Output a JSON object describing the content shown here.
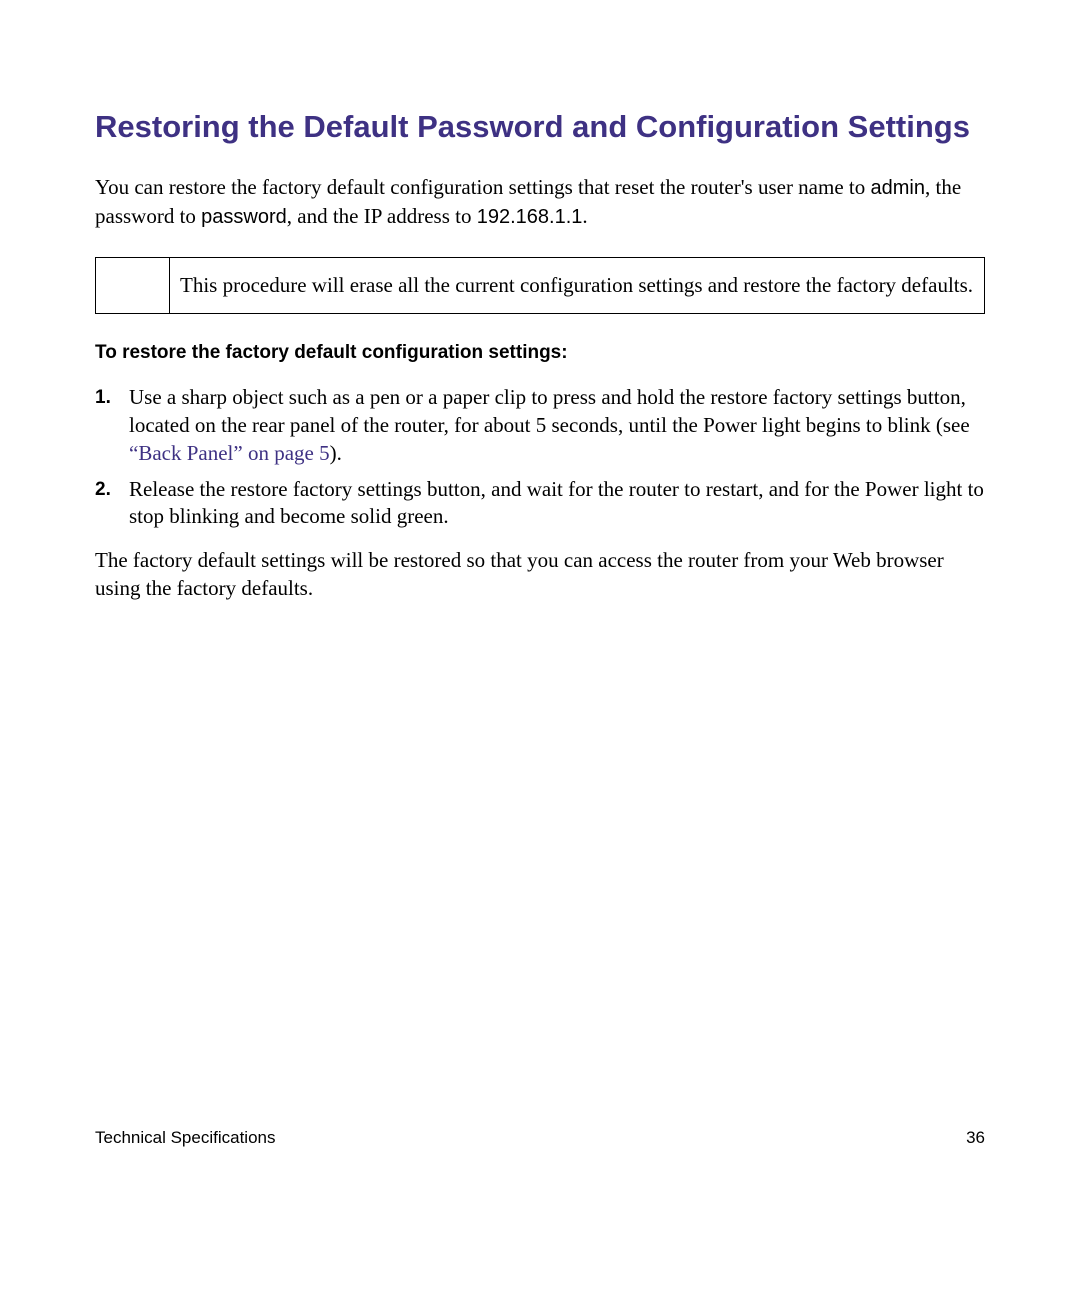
{
  "heading": "Restoring the Default Password and Configuration Settings",
  "intro": {
    "part1": "You can restore the factory default configuration settings that reset the router's user name to ",
    "username": "admin",
    "part2": ", the password to ",
    "password": "password",
    "part3": ", and the IP address to ",
    "ip": "192.168.1.1",
    "part4": "."
  },
  "note": "This procedure will erase all the current configuration settings and restore the factory defaults.",
  "subheading": "To restore the factory default configuration settings:",
  "steps": [
    {
      "num": "1.",
      "textBefore": "Use a sharp object such as a pen or a paper clip to press and hold the restore factory settings button, located on the rear panel of the router, for about 5 seconds, until the Power light begins to blink (see ",
      "link": "“Back Panel” on page 5",
      "textAfter": ")."
    },
    {
      "num": "2.",
      "textBefore": "Release the restore factory settings button, and wait for the router to restart, and for the Power light to stop blinking and become solid green.",
      "link": "",
      "textAfter": ""
    }
  ],
  "closing": "The factory default settings will be restored so that you can access the router from your Web browser using the factory defaults.",
  "footer": {
    "left": "Technical Specifications",
    "right": "36"
  }
}
